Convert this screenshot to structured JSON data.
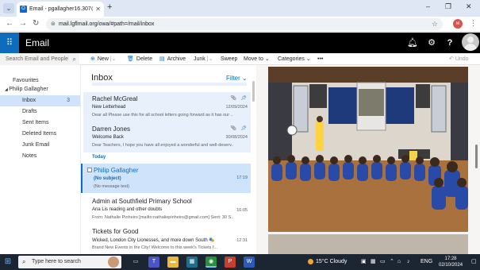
{
  "browser": {
    "tab_title": "Email - pgallagher16.307@lgfl...",
    "tab_favicon": "outlook-icon",
    "new_tab_label": "+",
    "url": "mail.lgflmail.org/owa/#path=/mail/inbox",
    "profile_initials": "M",
    "window_controls": [
      "–",
      "❐",
      "✕"
    ]
  },
  "outlook": {
    "app_title": "Email",
    "header_icons": [
      "bell-icon",
      "gear-icon",
      "help-icon"
    ]
  },
  "commandbar": {
    "search_placeholder": "Search Email and People",
    "new": "New",
    "delete": "Delete",
    "archive": "Archive",
    "junk": "Junk",
    "sweep": "Sweep",
    "move_to": "Move to",
    "categories": "Categories",
    "more": "•••",
    "undo": "Undo"
  },
  "folders": {
    "favourites": "Favourites",
    "account": "Philip Gallagher",
    "items": [
      {
        "label": "Inbox",
        "count": "3"
      },
      {
        "label": "Drafts",
        "count": ""
      },
      {
        "label": "Sent Items",
        "count": ""
      },
      {
        "label": "Deleted Items",
        "count": ""
      },
      {
        "label": "Junk Email",
        "count": ""
      },
      {
        "label": "Notes",
        "count": ""
      }
    ]
  },
  "messagelist": {
    "title": "Inbox",
    "filter": "Filter",
    "today_header": "Today",
    "messages": [
      {
        "from": "Rachel McGreal",
        "subject": "New Letterhead",
        "preview": "Dear all Please use this for all school letters going forward as it has our ...",
        "date": "12/09/2024"
      },
      {
        "from": "Darren Jones",
        "subject": "Welcome Back",
        "preview": "Dear Teachers, I hope you have all enjoyed a wonderful and well-deserv...",
        "date": "30/08/2024"
      },
      {
        "from": "Philip Gallagher",
        "subject": "(No subject)",
        "preview": "(No message text)",
        "date": "17:19"
      },
      {
        "from": "Admin at Southfield Primary School",
        "subject": "Ana Lis reading and other doubts",
        "preview": "From: Nathalie Pinheiro [mailto:nathaliepinheiro@gmail.com] Sent: 30 S...",
        "date": "16:05"
      },
      {
        "from": "Tickets for Good",
        "subject": "Wicked, London City Lionesses, and more down South 🎭",
        "preview": "Brand New Events in the City! Welcome to this week's Tickets f...",
        "date": "12:31"
      }
    ]
  },
  "taskbar": {
    "search_placeholder": "Type here to search",
    "weather": "15°C  Cloudy",
    "language": "ENG",
    "time": "17:28",
    "date": "02/10/2024"
  }
}
